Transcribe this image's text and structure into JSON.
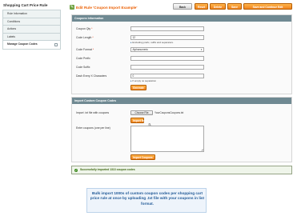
{
  "sidebar": {
    "title": "Shopping Cart Price Rule",
    "tabs": [
      {
        "label": "Rule Information"
      },
      {
        "label": "Conditions"
      },
      {
        "label": "Actions"
      },
      {
        "label": "Labels"
      },
      {
        "label": "Manage Coupon Codes",
        "active": true
      }
    ]
  },
  "header": {
    "icon": "edit-rule-icon",
    "title": "Edit Rule 'Coupon Import Example'",
    "buttons": {
      "back": "Back",
      "reset": "Reset",
      "delete": "Delete",
      "save": "Save",
      "save_continue": "Save and Continue Edit"
    }
  },
  "coupons_info": {
    "heading": "Coupons Information",
    "fields": {
      "qty_label": "Coupon Qty",
      "qty_value": "",
      "length_label": "Code Length",
      "length_value": "12",
      "length_note": "Excluding prefix, suffix and separators.",
      "format_label": "Code Format",
      "format_value": "Alphanumeric",
      "prefix_label": "Code Prefix",
      "prefix_value": "",
      "suffix_label": "Code Suffix",
      "suffix_value": "",
      "dash_label": "Dash Every X Characters",
      "dash_value": "0",
      "dash_note": "If empty no separation"
    },
    "generate_label": "Generate"
  },
  "import_section": {
    "heading": "Import Custom Coupon Codes",
    "file_label": "Import .txt file with coupons",
    "choose_file_label": "Choose File",
    "file_name": "YourCouponsCoupons.txt",
    "upload_label": "Import Now",
    "enter_label": "Enter coupons (one per line)",
    "textarea_value": "",
    "import_button_label": "Import Coupons"
  },
  "message": {
    "text": "Successfully imported 1313 coupon codes",
    "icon": "success-check-icon"
  },
  "caption": {
    "text": "Bulk import 1000s of custom coupon codes per shopping cart price rule at once by uploading .txt file with your coupons in list format."
  },
  "colors": {
    "accent": "#eb5e00",
    "section_header": "#6f8992",
    "button": "#f0831e",
    "success": "#3d6611",
    "caption": "#1f5896"
  }
}
